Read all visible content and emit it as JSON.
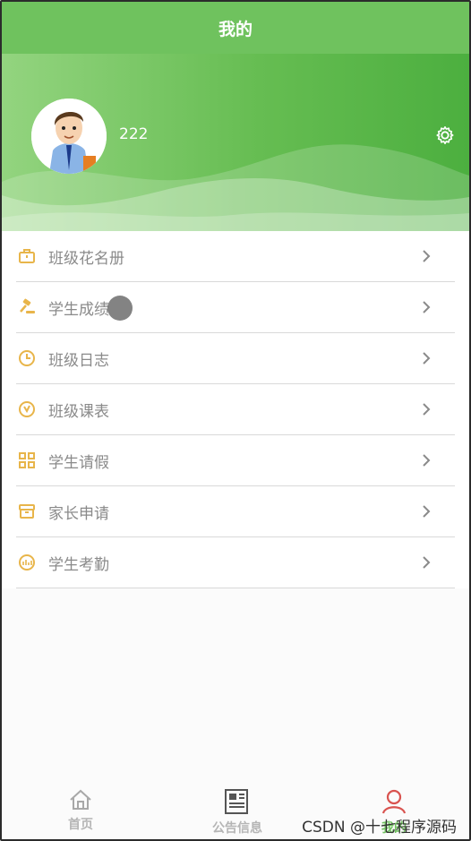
{
  "header": {
    "title": "我的"
  },
  "profile": {
    "username": "222"
  },
  "colors": {
    "accent": "#6fc25e",
    "menu_icon": "#e8b54a",
    "tab_active": "#d9534f"
  },
  "menu": [
    {
      "label": "班级花名册",
      "icon": "briefcase-icon"
    },
    {
      "label": "学生成绩",
      "icon": "gavel-icon"
    },
    {
      "label": "班级日志",
      "icon": "clock-icon"
    },
    {
      "label": "班级课表",
      "icon": "dial-icon"
    },
    {
      "label": "学生请假",
      "icon": "grid-icon"
    },
    {
      "label": "家长申请",
      "icon": "archive-icon"
    },
    {
      "label": "学生考勤",
      "icon": "chart-circle-icon"
    }
  ],
  "tabs": [
    {
      "label": "首页",
      "icon": "home-icon"
    },
    {
      "label": "公告信息",
      "icon": "newspaper-icon"
    },
    {
      "label": "我的",
      "icon": "user-icon"
    }
  ],
  "watermark": "CSDN @十七程序源码"
}
